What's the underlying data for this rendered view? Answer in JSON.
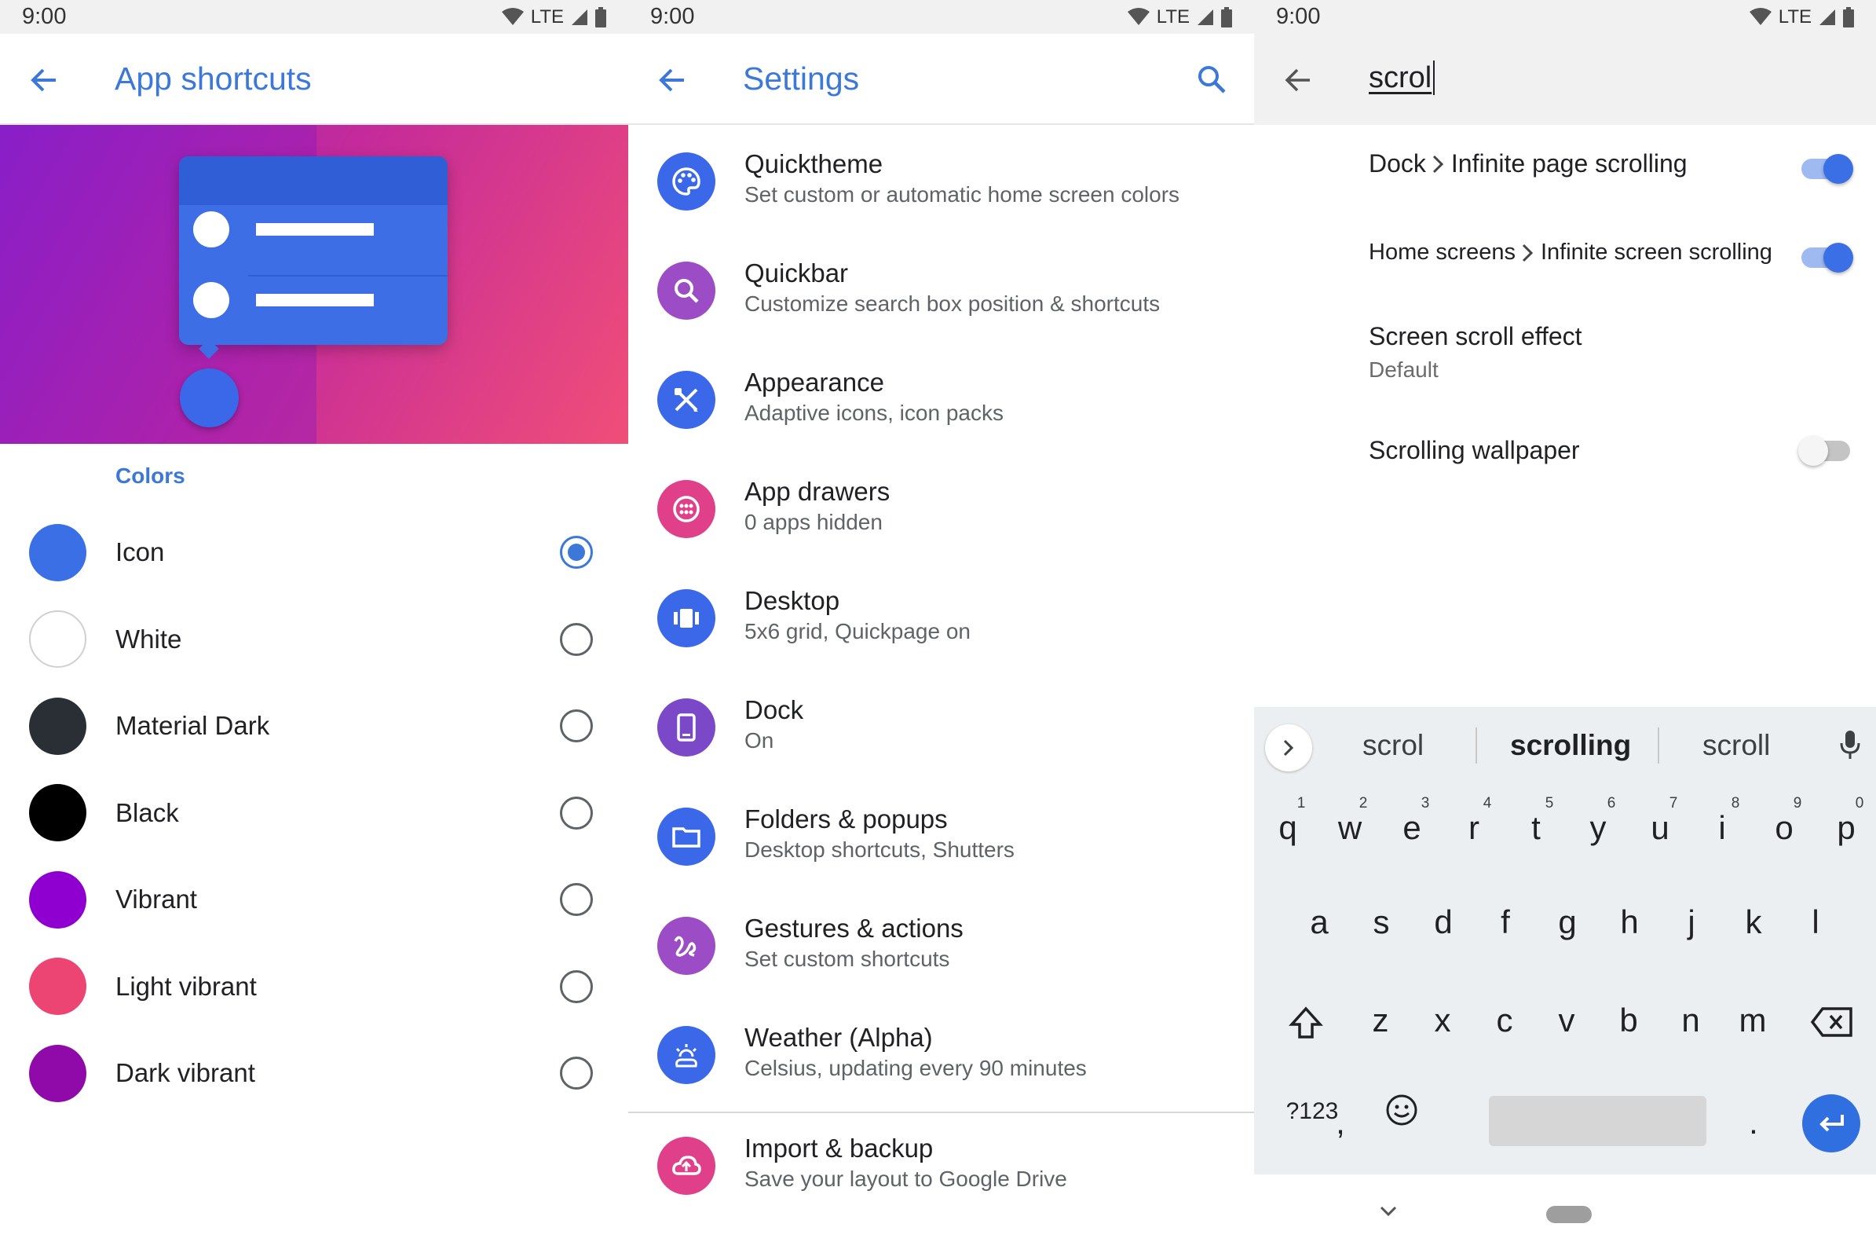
{
  "status": {
    "time": "9:00",
    "network": "LTE"
  },
  "shortcuts": {
    "title": "App shortcuts",
    "section": "Colors",
    "options": [
      {
        "label": "Icon",
        "color": "#3a6fe6",
        "selected": true
      },
      {
        "label": "White",
        "color": "#ffffff",
        "selected": false
      },
      {
        "label": "Material Dark",
        "color": "#2a2f35",
        "selected": false
      },
      {
        "label": "Black",
        "color": "#000000",
        "selected": false
      },
      {
        "label": "Vibrant",
        "color": "#8f00d0",
        "selected": false
      },
      {
        "label": "Light vibrant",
        "color": "#ec4573",
        "selected": false
      },
      {
        "label": "Dark vibrant",
        "color": "#8f0aa8",
        "selected": false
      }
    ]
  },
  "settings": {
    "title": "Settings",
    "items": [
      {
        "title": "Quicktheme",
        "subtitle": "Set custom or automatic home screen colors",
        "icon": "palette-icon",
        "color": "#3a68e8"
      },
      {
        "title": "Quickbar",
        "subtitle": "Customize search box position & shortcuts",
        "icon": "search-icon",
        "color": "#9c4cc4"
      },
      {
        "title": "Appearance",
        "subtitle": "Adaptive icons, icon packs",
        "icon": "brush-icon",
        "color": "#3a68e8"
      },
      {
        "title": "App drawers",
        "subtitle": "0 apps hidden",
        "icon": "app-drawer-icon",
        "color": "#e0408a"
      },
      {
        "title": "Desktop",
        "subtitle": "5x6 grid, Quickpage on",
        "icon": "desktop-icon",
        "color": "#3a68e8"
      },
      {
        "title": "Dock",
        "subtitle": "On",
        "icon": "dock-icon",
        "color": "#7b48c8"
      },
      {
        "title": "Folders & popups",
        "subtitle": "Desktop shortcuts, Shutters",
        "icon": "folder-icon",
        "color": "#3a68e8"
      },
      {
        "title": "Gestures & actions",
        "subtitle": "Set custom shortcuts",
        "icon": "gesture-icon",
        "color": "#9c4cc4"
      },
      {
        "title": "Weather (Alpha)",
        "subtitle": "Celsius, updating every 90 minutes",
        "icon": "weather-icon",
        "color": "#3a68e8"
      },
      {
        "title": "Import & backup",
        "subtitle": "Save your layout to Google Drive",
        "icon": "cloud-upload-icon",
        "color": "#e0408a"
      }
    ]
  },
  "search": {
    "query": "scrol",
    "results": [
      {
        "parent": "Dock",
        "title": "Infinite page scrolling",
        "toggle": "on"
      },
      {
        "parent": "Home screens",
        "title": "Infinite screen scrolling",
        "toggle": "on"
      },
      {
        "title": "Screen scroll effect",
        "subtitle": "Default"
      },
      {
        "title": "Scrolling wallpaper",
        "toggle": "off"
      }
    ]
  },
  "keyboard": {
    "suggestions": [
      "scrol",
      "scrolling",
      "scroll"
    ],
    "row1": [
      "q",
      "w",
      "e",
      "r",
      "t",
      "y",
      "u",
      "i",
      "o",
      "p"
    ],
    "row1_hints": [
      "1",
      "2",
      "3",
      "4",
      "5",
      "6",
      "7",
      "8",
      "9",
      "0"
    ],
    "row2": [
      "a",
      "s",
      "d",
      "f",
      "g",
      "h",
      "j",
      "k",
      "l"
    ],
    "row3": [
      "z",
      "x",
      "c",
      "v",
      "b",
      "n",
      "m"
    ],
    "symbols_label": "?123",
    "comma": ",",
    "period": "."
  }
}
